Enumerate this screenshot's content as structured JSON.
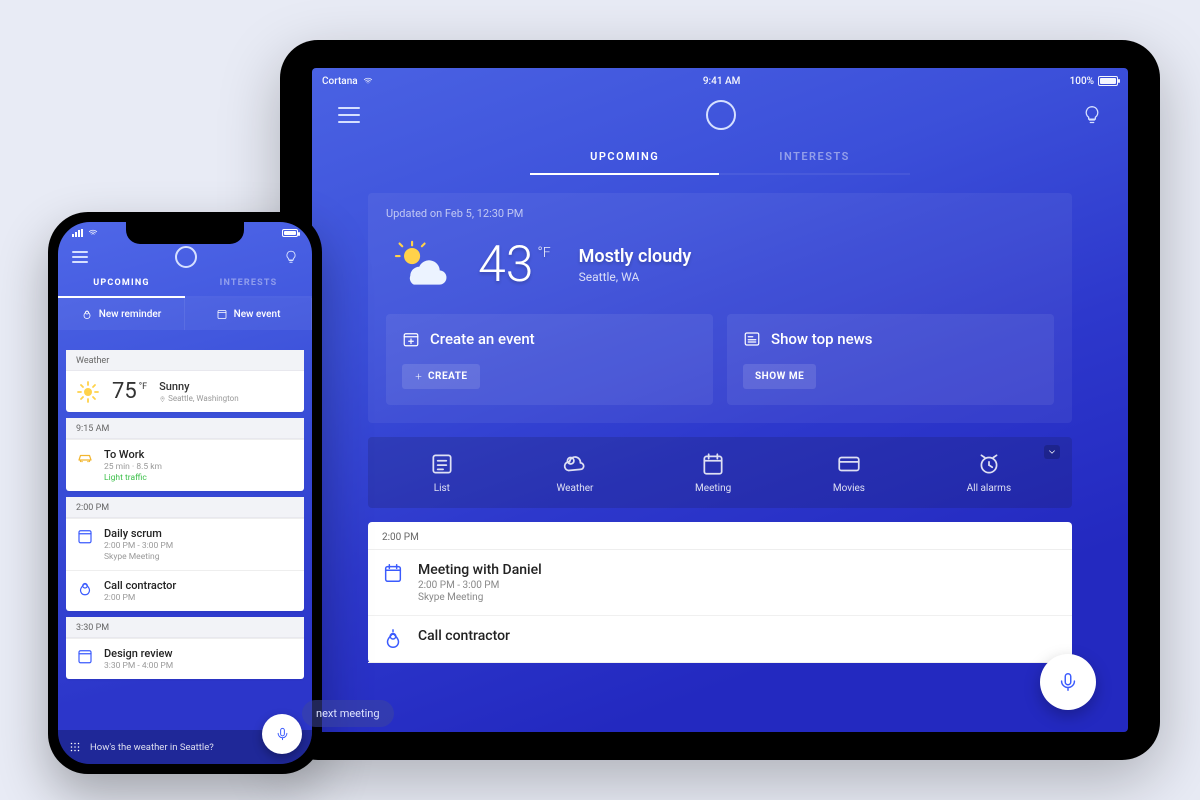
{
  "tablet": {
    "status": {
      "app_name": "Cortana",
      "clock": "9:41 AM",
      "battery": "100%"
    },
    "tabs": {
      "upcoming": "UPCOMING",
      "interests": "INTERESTS"
    },
    "updated_text": "Updated on Feb 5, 12:30 PM",
    "weather": {
      "temp": "43",
      "unit": "°F",
      "condition": "Mostly cloudy",
      "location": "Seattle, WA"
    },
    "actions": {
      "event": {
        "title": "Create an event",
        "btn": "CREATE"
      },
      "news": {
        "title": "Show top news",
        "btn": "SHOW ME"
      }
    },
    "quick": {
      "list": "List",
      "weather": "Weather",
      "meeting": "Meeting",
      "movies": "Movies",
      "alarms": "All alarms"
    },
    "agenda": {
      "slot1_label": "2:00 PM",
      "item1": {
        "title": "Meeting with Daniel",
        "range": "2:00 PM - 3:00 PM",
        "sub": "Skype Meeting"
      },
      "item2": {
        "title": "Call contractor"
      }
    }
  },
  "phone": {
    "tabs": {
      "upcoming": "UPCOMING",
      "interests": "INTERESTS"
    },
    "quick": {
      "reminder": "New reminder",
      "event": "New event"
    },
    "weather": {
      "header": "Weather",
      "temp": "75",
      "unit": "°F",
      "condition": "Sunny",
      "location": "Seattle, Washington"
    },
    "slot1": {
      "label": "9:15 AM",
      "title": "To Work",
      "sub": "25 min · 8.5 km",
      "traffic": "Light traffic"
    },
    "slot2": {
      "label": "2:00 PM",
      "item1": {
        "title": "Daily scrum",
        "range": "2:00 PM - 3:00 PM",
        "sub": "Skype Meeting"
      },
      "item2": {
        "title": "Call contractor",
        "range": "2:00 PM"
      }
    },
    "slot3": {
      "label": "3:30 PM",
      "item1": {
        "title": "Design review",
        "range": "3:30 PM - 4:00 PM"
      }
    },
    "footer_prompt": "How's the weather in Seattle?",
    "suggestion_chip": "next meeting"
  }
}
